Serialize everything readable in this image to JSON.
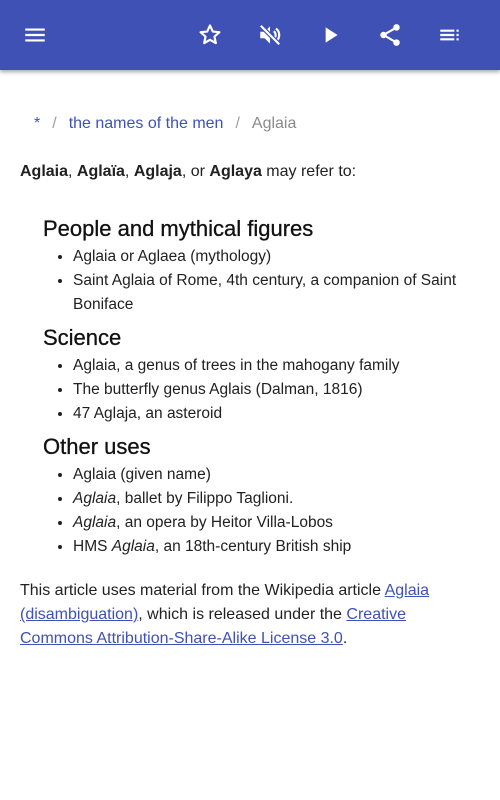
{
  "toolbar": {
    "menu_icon": "hamburger-menu-icon",
    "favorite_icon": "star-outline-icon",
    "mute_icon": "volume-off-icon",
    "play_icon": "play-icon",
    "share_icon": "share-icon",
    "toc_icon": "list-icon",
    "color": "#3f51b5"
  },
  "breadcrumb": {
    "root": "*",
    "separator": "/",
    "parent": "the names of the men",
    "current": "Aglaia"
  },
  "intro": {
    "term1": "Aglaia",
    "sep1": ", ",
    "term2": "Aglaïa",
    "sep2": ", ",
    "term3": "Aglaja",
    "sep3": ", or ",
    "term4": "Aglaya",
    "suffix": " may refer to:"
  },
  "sections": [
    {
      "title": "People and mythical figures",
      "items": [
        "Aglaia or Aglaea (mythology)",
        "Saint Aglaia of Rome, 4th century, a companion of Saint Boniface"
      ]
    },
    {
      "title": "Science",
      "items": [
        "Aglaia, a genus of trees in the mahogany family",
        "The butterfly genus Aglais (Dalman, 1816)",
        "47 Aglaja, an asteroid"
      ]
    },
    {
      "title": "Other uses",
      "items": [
        {
          "plain": "Aglaia (given name)"
        },
        {
          "em": "Aglaia",
          "rest": ", ballet by Filippo Taglioni."
        },
        {
          "em": "Aglaia",
          "rest": ", an opera by Heitor Villa-Lobos"
        },
        {
          "pre": "HMS ",
          "em": "Aglaia",
          "rest": ", an 18th-century British ship"
        }
      ]
    }
  ],
  "footer": {
    "text1": "This article uses material from the Wikipedia article ",
    "link1": "Aglaia (disambiguation)",
    "text2": ", which is released under the ",
    "link2": "Creative Commons Attribution-Share-Alike License 3.0",
    "text3": "."
  }
}
